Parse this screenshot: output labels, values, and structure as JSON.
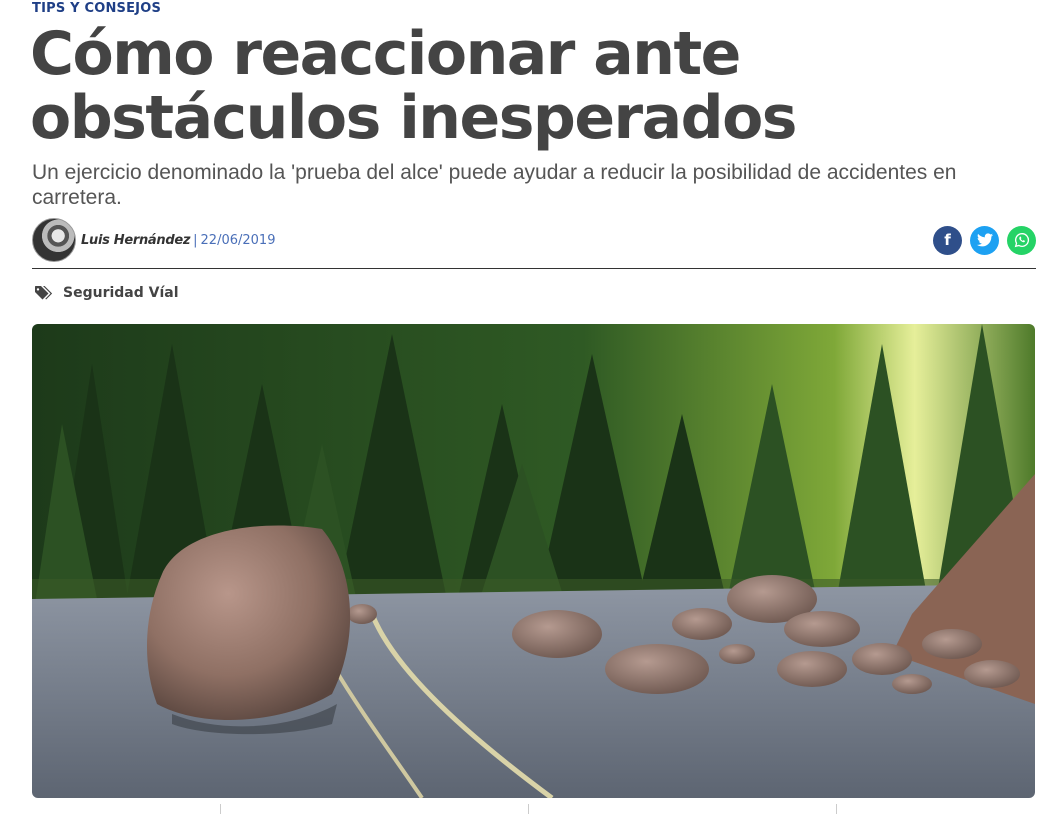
{
  "article": {
    "category": "TIPS Y CONSEJOS",
    "title": "Cómo reaccionar ante obstáculos inesperados",
    "subtitle": "Un ejercicio denominado la 'prueba del alce' puede ayudar a reducir la posibilidad de accidentes en carretera.",
    "author": "Luis Hernández",
    "separator": "|",
    "date": "22/06/2019",
    "tag": "Seguridad Víal"
  },
  "share": {
    "facebook": {
      "icon": "facebook-icon",
      "glyph": "f",
      "color": "#2f4f8a"
    },
    "twitter": {
      "icon": "twitter-icon",
      "color": "#1da1f2"
    },
    "whatsapp": {
      "icon": "whatsapp-icon",
      "color": "#25d366"
    }
  },
  "colors": {
    "category": "#1f3f86",
    "headline": "#444444",
    "date": "#4a6fb8"
  }
}
